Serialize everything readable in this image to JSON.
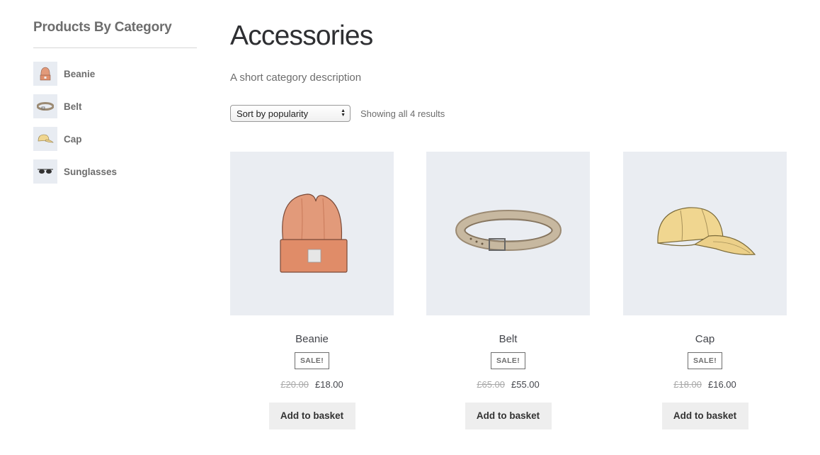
{
  "sidebar": {
    "title": "Products By Category",
    "items": [
      {
        "label": "Beanie",
        "icon": "beanie-icon"
      },
      {
        "label": "Belt",
        "icon": "belt-icon"
      },
      {
        "label": "Cap",
        "icon": "cap-icon"
      },
      {
        "label": "Sunglasses",
        "icon": "sunglasses-icon"
      }
    ]
  },
  "main": {
    "title": "Accessories",
    "description": "A short category description",
    "sort": {
      "selected": "Sort by popularity"
    },
    "result_count": "Showing all 4 results",
    "products": [
      {
        "name": "Beanie",
        "badge": "SALE!",
        "old_price": "£20.00",
        "price": "£18.00",
        "button": "Add to basket",
        "image": "beanie-image"
      },
      {
        "name": "Belt",
        "badge": "SALE!",
        "old_price": "£65.00",
        "price": "£55.00",
        "button": "Add to basket",
        "image": "belt-image"
      },
      {
        "name": "Cap",
        "badge": "SALE!",
        "old_price": "£18.00",
        "price": "£16.00",
        "button": "Add to basket",
        "image": "cap-image"
      }
    ]
  },
  "colors": {
    "beanie": "#e29a7a",
    "belt": "#b5a48e",
    "cap": "#f0d690",
    "image_bg": "#eaedf2"
  }
}
